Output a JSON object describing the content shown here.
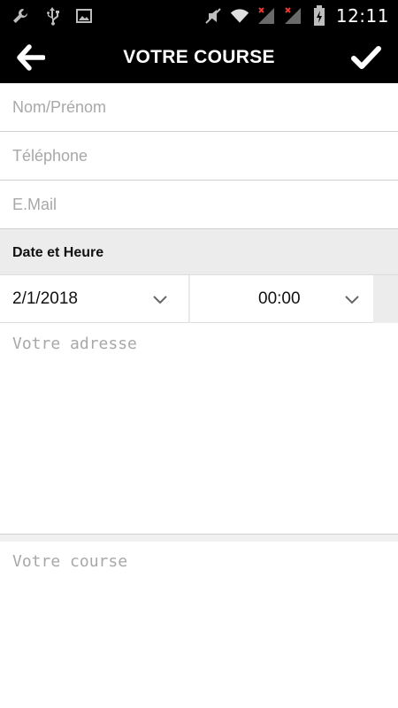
{
  "status_bar": {
    "time": "12:11",
    "left_icons": [
      "wrench-icon",
      "usb-icon",
      "image-icon"
    ],
    "right_icons": [
      "mute-icon",
      "wifi-icon",
      "signal-icon",
      "signal-icon",
      "battery-icon"
    ]
  },
  "app_bar": {
    "title": "VOTRE COURSE",
    "back_icon": "arrow-left-icon",
    "confirm_icon": "check-icon"
  },
  "form": {
    "name_placeholder": "Nom/Prénom",
    "phone_placeholder": "Téléphone",
    "email_placeholder": "E.Mail",
    "section_label": "Date et Heure",
    "date_value": "2/1/2018",
    "time_value": "00:00",
    "address_placeholder": "Votre adresse",
    "course_placeholder": "Votre course"
  },
  "colors": {
    "bar_background": "#000000",
    "section_background": "#ececec",
    "placeholder": "#a8a8a8"
  }
}
